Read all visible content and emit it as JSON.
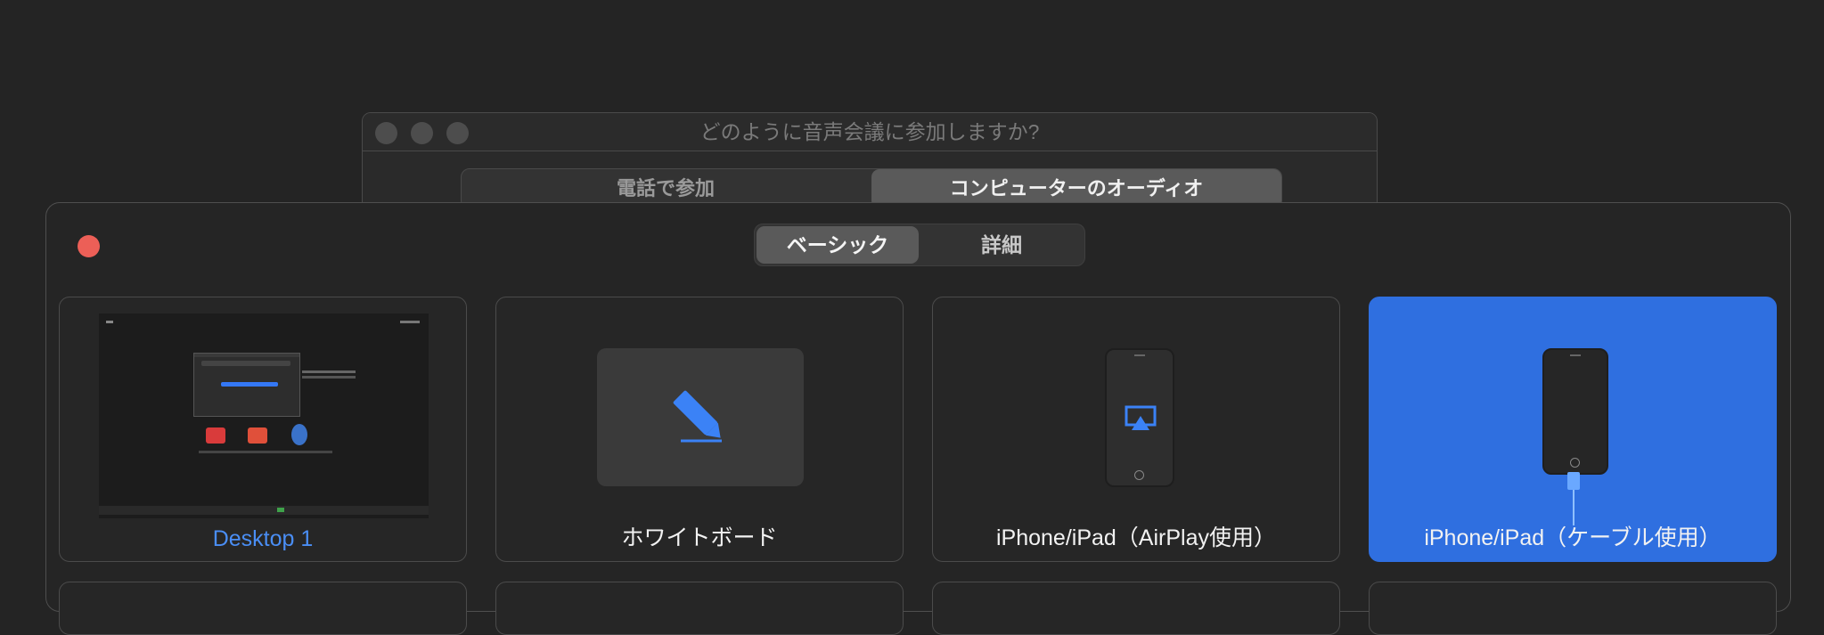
{
  "audio_dialog": {
    "title": "どのように音声会議に参加しますか?",
    "tabs": [
      {
        "label": "電話で参加",
        "active": false
      },
      {
        "label": "コンピューターのオーディオ",
        "active": true
      }
    ]
  },
  "share_window": {
    "tabs": [
      {
        "label": "ベーシック",
        "active": true
      },
      {
        "label": "詳細",
        "active": false
      }
    ],
    "cards": [
      {
        "label": "Desktop 1",
        "thumbnail": "desktop-screenshot",
        "selected": false
      },
      {
        "label": "ホワイトボード",
        "thumbnail": "pen-icon",
        "selected": false
      },
      {
        "label": "iPhone/iPad（AirPlay使用）",
        "thumbnail": "airplay-icon",
        "selected": false
      },
      {
        "label": "iPhone/iPad（ケーブル使用）",
        "thumbnail": "cable-phone-icon",
        "selected": true
      }
    ]
  },
  "colors": {
    "accent": "#2f6fe0",
    "close": "#ec5f57",
    "label_blue": "#4a8ef5"
  }
}
